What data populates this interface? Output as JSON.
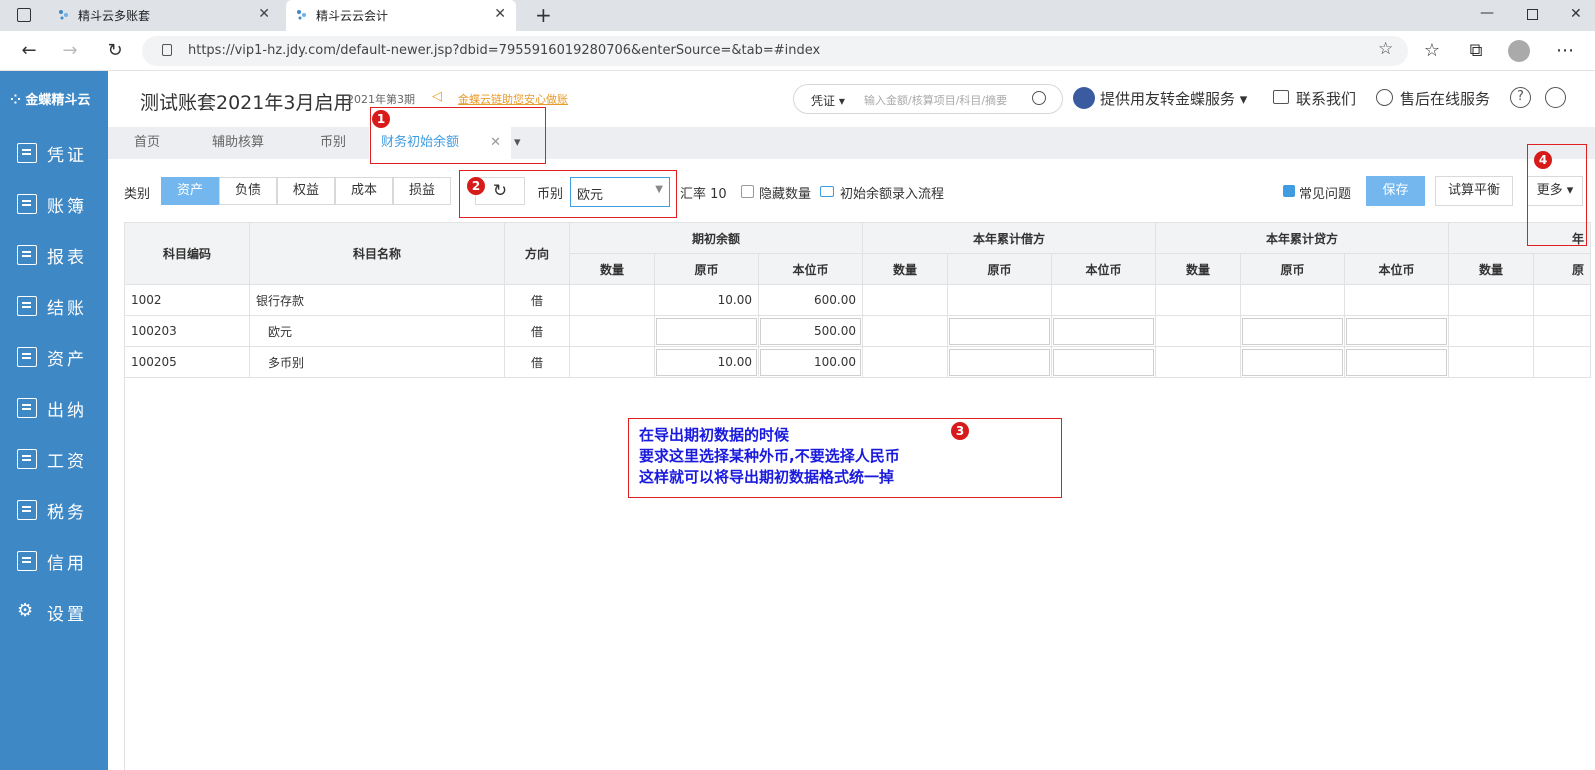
{
  "browser": {
    "tabs": [
      {
        "label": "精斗云多账套"
      },
      {
        "label": "精斗云云会计"
      }
    ],
    "url": "https://vip1-hz.jdy.com/default-newer.jsp?dbid=7955916019280706&enterSource=&tab=#index"
  },
  "sidebar": {
    "logo": "金蝶精斗云",
    "items": [
      {
        "label": "凭证"
      },
      {
        "label": "账簿"
      },
      {
        "label": "报表"
      },
      {
        "label": "结账"
      },
      {
        "label": "资产"
      },
      {
        "label": "出纳"
      },
      {
        "label": "工资"
      },
      {
        "label": "税务"
      },
      {
        "label": "信用"
      },
      {
        "label": "设置"
      }
    ]
  },
  "header": {
    "title": "测试账套2021年3月启用",
    "period": "2021年第3期",
    "notice": "金蝶云链助您安心做账",
    "search_type": "凭证",
    "search_placeholder": "输入金额/核算项目/科目/摘要",
    "links": [
      "提供用友转金蝶服务",
      "联系我们",
      "售后在线服务"
    ]
  },
  "module_tabs": [
    "首页",
    "辅助核算",
    "币别",
    "财务初始余额"
  ],
  "toolbar": {
    "category_label": "类别",
    "categories": [
      "资产",
      "负债",
      "权益",
      "成本",
      "损益"
    ],
    "currency_label": "币别",
    "currency_value": "欧元",
    "rate": "汇率 10",
    "hide_qty": "隐藏数量",
    "flow": "初始余额录入流程",
    "faq": "常见问题",
    "save": "保存",
    "trial": "试算平衡",
    "more": "更多"
  },
  "table": {
    "headers": {
      "code": "科目编码",
      "name": "科目名称",
      "dir": "方向",
      "groups": [
        "期初余额",
        "本年累计借方",
        "本年累计贷方"
      ],
      "cut_group": "年",
      "sub": [
        "数量",
        "原币",
        "本位币"
      ],
      "cut_sub": "原"
    },
    "rows": [
      {
        "code": "1002",
        "name": "银行存款",
        "dir": "借",
        "orig": "10.00",
        "base": "600.00"
      },
      {
        "code": "100203",
        "name": "欧元",
        "dir": "借",
        "orig": "",
        "base": "500.00"
      },
      {
        "code": "100205",
        "name": "多币别",
        "dir": "借",
        "orig": "10.00",
        "base": "100.00"
      }
    ]
  },
  "annotation": {
    "badges": [
      "1",
      "2",
      "3",
      "4"
    ],
    "lines": [
      "在导出期初数据的时候",
      "要求这里选择某种外币,不要选择人民币",
      "这样就可以将导出期初数据格式统一掉"
    ]
  },
  "colors": {
    "sidebar": "#3f88c6",
    "accent": "#74b7ef",
    "annotation": "#e02020",
    "note_text": "#1a1adf"
  }
}
